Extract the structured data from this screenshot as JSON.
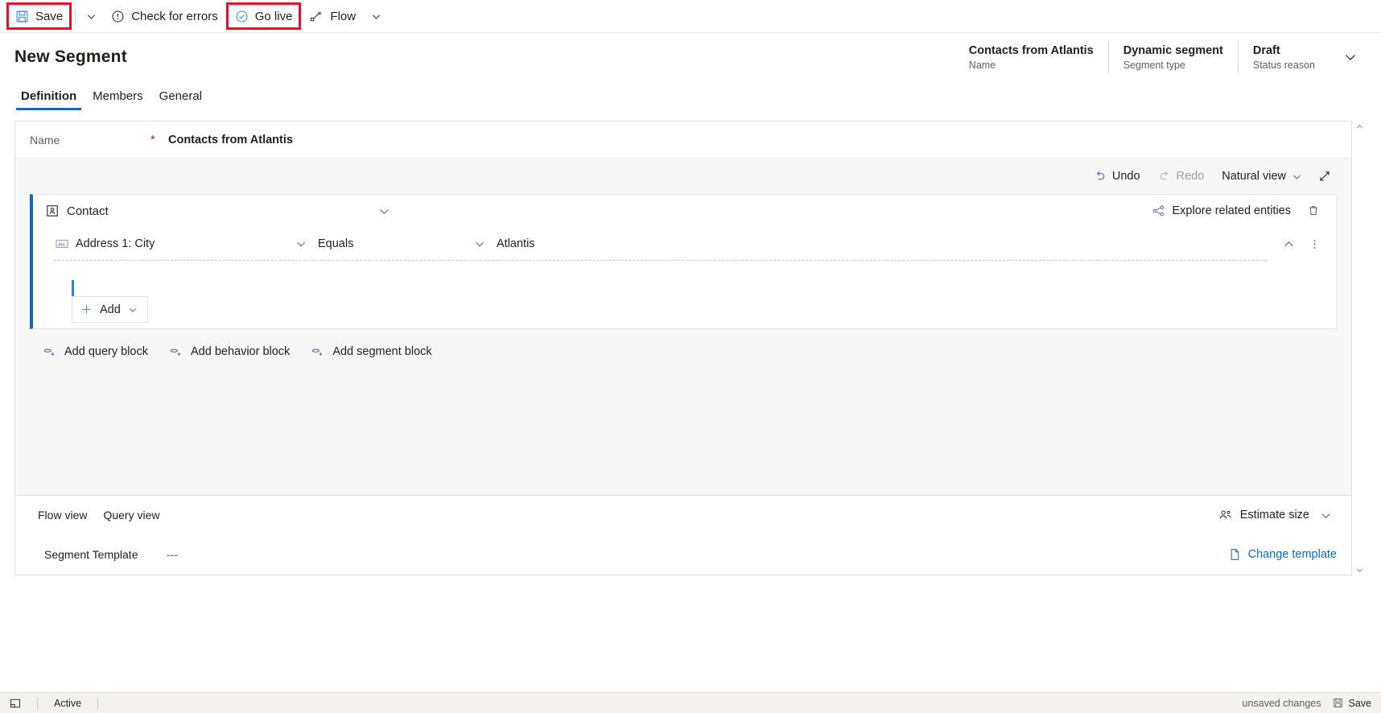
{
  "command_bar": {
    "save": {
      "label": "Save",
      "icon": "save-icon",
      "highlighted": true
    },
    "save_caret": "chevron-down-icon",
    "check_errors": {
      "label": "Check for errors",
      "icon": "error-circle-icon"
    },
    "go_live": {
      "label": "Go live",
      "icon": "check-circle-icon",
      "highlighted": true
    },
    "flow": {
      "label": "Flow",
      "icon": "flow-icon"
    },
    "flow_caret": "chevron-down-icon",
    "highlight_color": "#e81123"
  },
  "header": {
    "title": "New Segment",
    "fields": [
      {
        "value": "Contacts from Atlantis",
        "label": "Name"
      },
      {
        "value": "Dynamic segment",
        "label": "Segment type"
      },
      {
        "value": "Draft",
        "label": "Status reason"
      }
    ],
    "expand_icon": "chevron-down-icon"
  },
  "tabs": [
    {
      "label": "Definition",
      "active": true
    },
    {
      "label": "Members",
      "active": false
    },
    {
      "label": "General",
      "active": false
    }
  ],
  "name_row": {
    "label": "Name",
    "required_marker": "*",
    "value": "Contacts from Atlantis"
  },
  "canvas_toolbar": {
    "undo": {
      "label": "Undo",
      "icon": "undo-icon",
      "enabled": true
    },
    "redo": {
      "label": "Redo",
      "icon": "redo-icon",
      "enabled": false
    },
    "view_mode": {
      "label": "Natural view",
      "caret": "chevron-down-icon"
    },
    "expand": "expand-diagonal-icon"
  },
  "query_block": {
    "entity": {
      "label": "Contact",
      "icon": "contact-entity-icon"
    },
    "collapse_caret": "chevron-down-icon",
    "explore": {
      "label": "Explore related entities",
      "icon": "related-entities-icon"
    },
    "delete_icon": "trash-icon",
    "condition": {
      "attribute": "Address 1: City",
      "attribute_icon": "text-field-abc-icon",
      "operator": "Equals",
      "value": "Atlantis",
      "collapse_icon": "chevron-up-icon",
      "more_icon": "more-vertical-icon"
    },
    "add_button": {
      "label": "Add",
      "icon": "plus-icon",
      "caret": "chevron-down-icon"
    }
  },
  "block_links": [
    {
      "label": "Add query block",
      "icon": "query-block-icon"
    },
    {
      "label": "Add behavior block",
      "icon": "behavior-block-icon"
    },
    {
      "label": "Add segment block",
      "icon": "segment-block-icon"
    }
  ],
  "panel_footer": {
    "view_tabs": [
      {
        "label": "Flow view"
      },
      {
        "label": "Query view"
      }
    ],
    "estimate": {
      "label": "Estimate size",
      "icon": "people-icon"
    },
    "estimate_caret": "chevron-down-icon",
    "template_label": "Segment Template",
    "template_value": "---",
    "change_template": {
      "label": "Change template",
      "icon": "document-icon"
    }
  },
  "status_bar": {
    "form_icon": "form-icon",
    "state": "Active",
    "unsaved": "unsaved changes",
    "save": {
      "label": "Save",
      "icon": "save-icon"
    }
  }
}
